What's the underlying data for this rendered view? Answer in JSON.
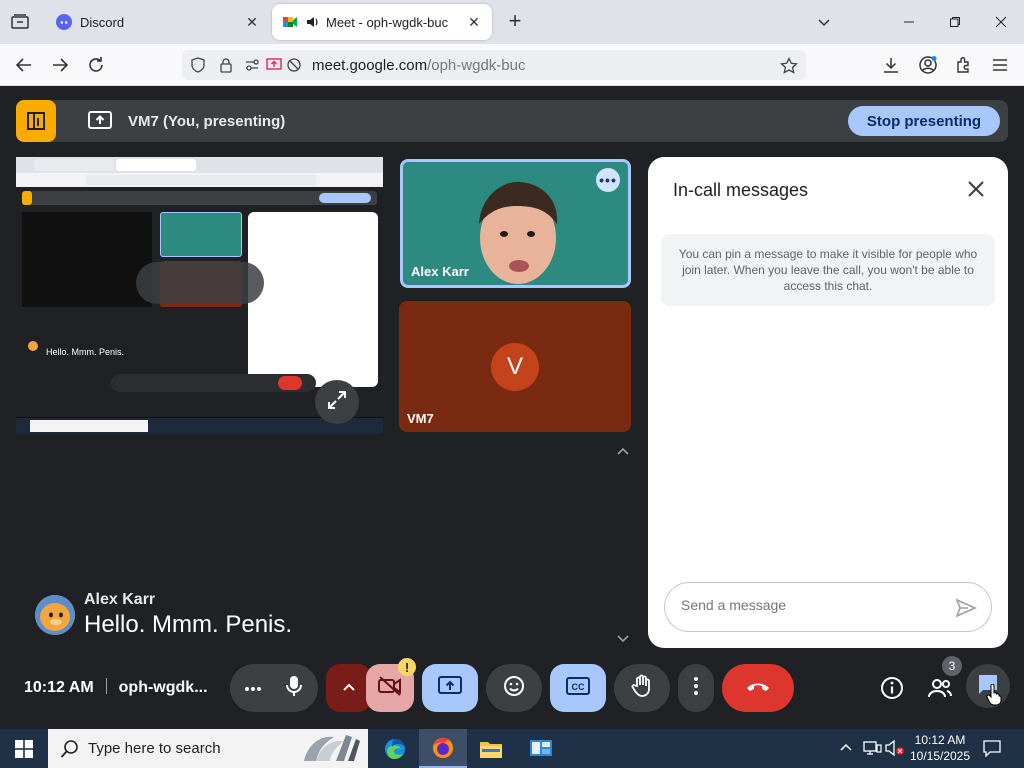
{
  "browser": {
    "tabs": [
      {
        "label": "Discord",
        "active": false
      },
      {
        "label": "Meet - oph-wgdk-buc",
        "active": true
      }
    ],
    "url_host": "meet.google.com",
    "url_path": "/oph-wgdk-buc"
  },
  "meet": {
    "presenting_label": "VM7 (You, presenting)",
    "stop_presenting_label": "Stop presenting",
    "participants": [
      {
        "name": "Alex Karr",
        "more_label": "•••"
      },
      {
        "name": "VM7",
        "initial": "V"
      }
    ],
    "caption": {
      "speaker": "Alex Karr",
      "text": "Hello. Mmm. Penis."
    },
    "chat": {
      "title": "In-call messages",
      "info": "You can pin a message to make it visible for people who join later. When you leave the call, you won't be able to access this chat.",
      "input_placeholder": "Send a message"
    },
    "time": "10:12 AM",
    "meeting_code": "oph-wgdk...",
    "warning_badge": "!",
    "people_count": "3",
    "colors": {
      "end_call": "#dc362e",
      "active_blue": "#a8c7fa",
      "presenting_yellow": "#f9ab00"
    }
  },
  "taskbar": {
    "search_placeholder": "Type here to search",
    "time": "10:12 AM",
    "date": "10/15/2025"
  }
}
